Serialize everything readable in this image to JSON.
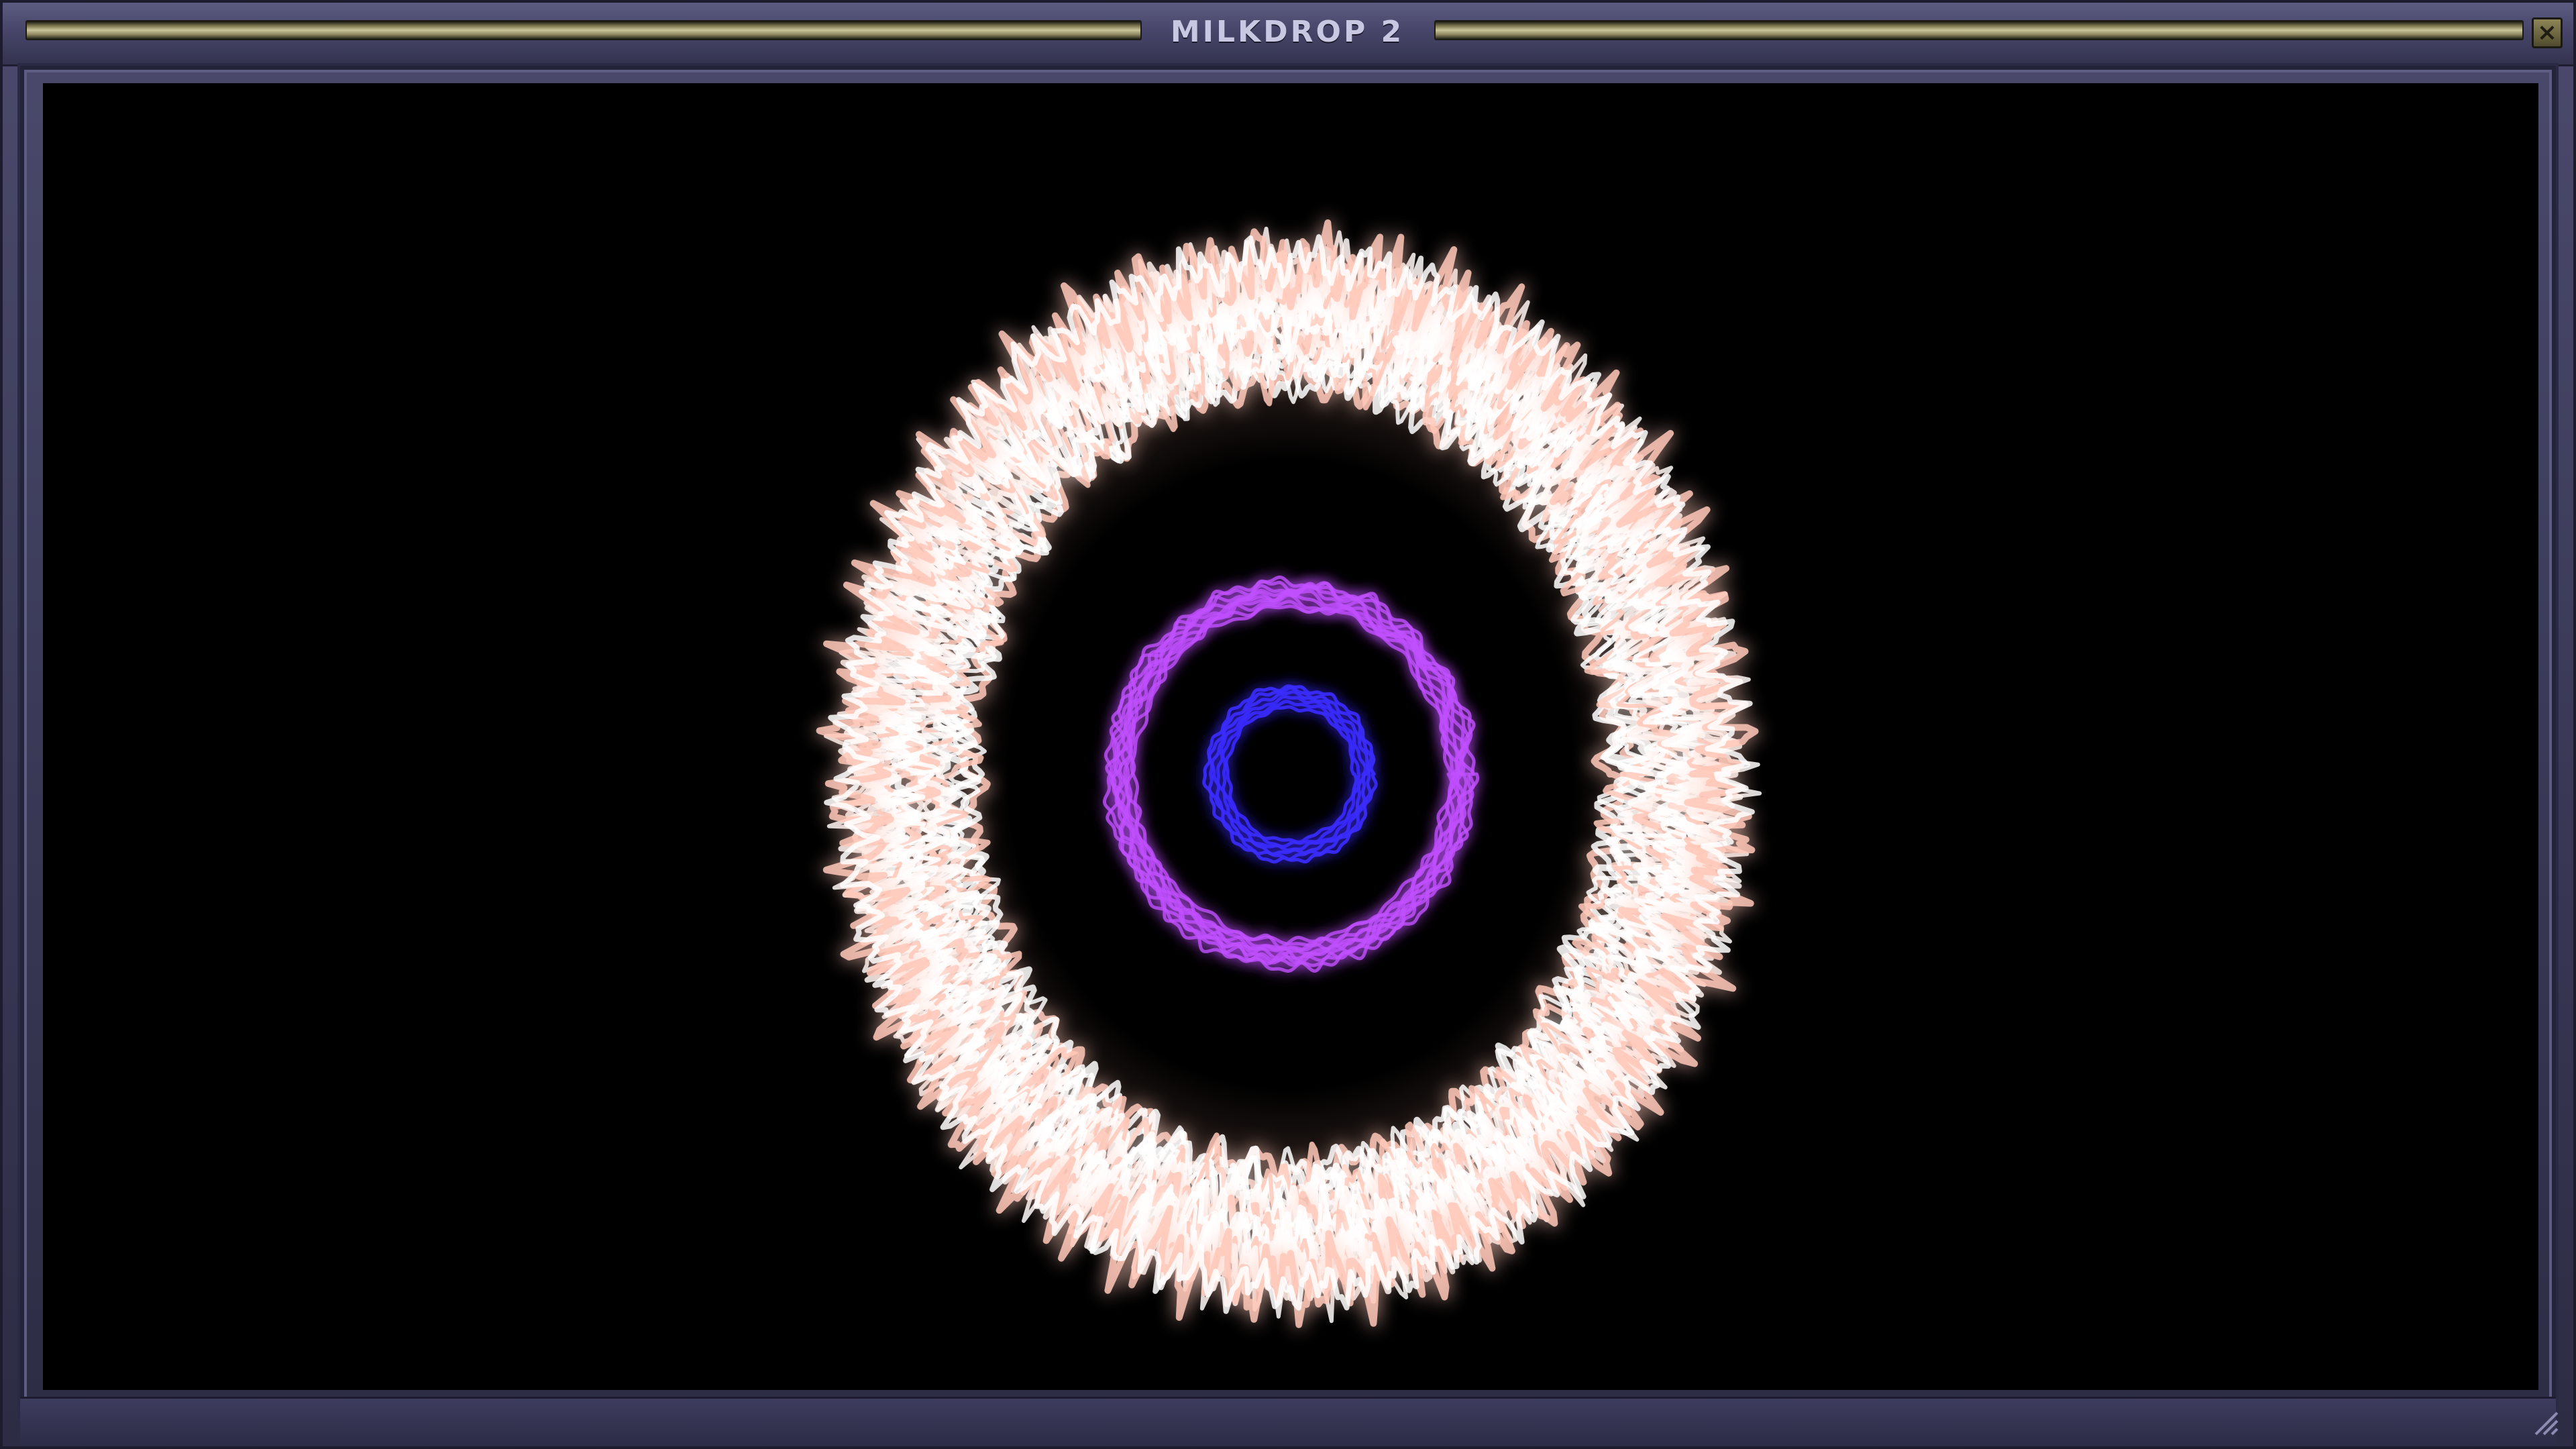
{
  "window": {
    "title": "MILKDROP 2",
    "close_symbol": "×"
  },
  "visualization": {
    "type": "spectrum-ring",
    "outer_ring_color": "#ffffff",
    "outer_glow_color": "#ffc8b8",
    "inner_ring_color": "#c050ff",
    "core_ring_color": "#3a2cff",
    "background_color": "#000000"
  },
  "icons": {
    "close": "close-icon",
    "resize": "resize-grip-icon"
  }
}
